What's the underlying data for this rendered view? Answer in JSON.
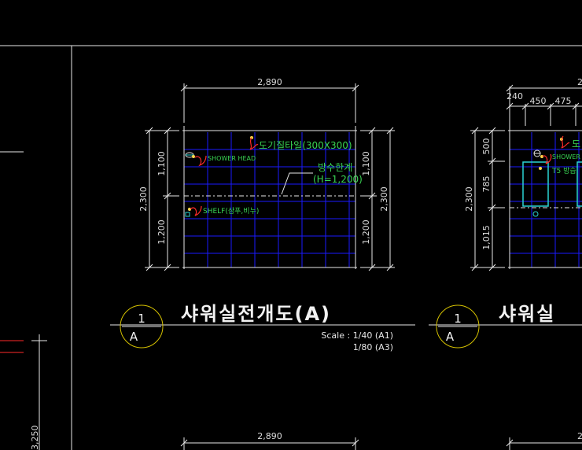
{
  "drawing_a": {
    "width_dim": "2,890",
    "left_height_total": "2,300",
    "left_upper": "1,100",
    "left_lower": "1,200",
    "right_height_total": "2,300",
    "right_upper": "1,100",
    "right_lower": "1,200",
    "label_tile": "도기질타일(300X300)",
    "label_shower_head": "SHOWER HEAD",
    "label_waterproof_1": "방수한계",
    "label_waterproof_2": "(H=1,200)",
    "label_shelf": "SHELF(샴푸,비누)",
    "circle_number": "1",
    "circle_letter": "A",
    "title": "샤워실전개도(A)",
    "scale_line1": "Scale : 1/40 (A1)",
    "scale_line2": "1/80 (A3)"
  },
  "drawing_b": {
    "dim_240": "240",
    "dim_450": "450",
    "dim_475": "475",
    "top_dim_partial": "2,",
    "left_total": "2,300",
    "left_500": "500",
    "left_785": "785",
    "left_1015": "1,015",
    "label_tile_partial": "도",
    "label_shower_partial": "SHOWER",
    "label_t5_partial": "T5 방습",
    "circle_number": "1",
    "circle_letter": "A",
    "title_partial": "샤워실"
  },
  "left_panel": {
    "vertical_dim": "3,250"
  },
  "bottom": {
    "dim_left": "2,890",
    "dim_right_partial": "2"
  },
  "colors": {
    "background": "#000000",
    "line": "#e8e8e8",
    "grid": "#1a1aff",
    "label_green": "#39d353",
    "accent_red": "#ff2a2a",
    "circle_yellow": "#d4c000",
    "cyan": "#2ad4d4"
  }
}
